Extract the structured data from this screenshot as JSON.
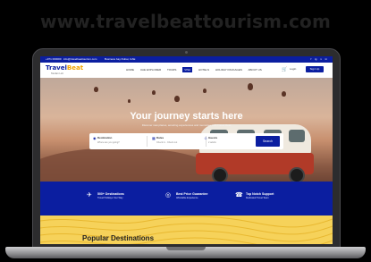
{
  "watermark": "www.travelbeattourism.com",
  "site": {
    "topbar": {
      "phone": "+971 000000",
      "email": "info@travelbeattourism.com",
      "address": "Business bay Dubai, UAE",
      "social": [
        "f",
        "ig",
        "x",
        "in"
      ]
    },
    "logo": {
      "text_main": "Travel",
      "text_accent": "Beat",
      "tagline": "Tourism LLC"
    },
    "menu": [
      "HOME",
      "UAE EXPLORER",
      "TOURS",
      "VISA",
      "HOTELS",
      "HOLIDAY PACKAGES",
      "ABOUT US"
    ],
    "menu_active_index": 3,
    "login_label": "Login",
    "signup_label": "Sign Up",
    "hero": {
      "title": "Your journey starts here",
      "subtitle": "Discover new places, amazing experiences and memories with Travel Beat",
      "search": {
        "fields": [
          {
            "icon": "pin-icon",
            "label": "Destination",
            "placeholder": "Where are you going?"
          },
          {
            "icon": "calendar-icon",
            "label": "Dates",
            "placeholder": "Check in - Check out"
          },
          {
            "icon": "guests-icon",
            "label": "Guests",
            "placeholder": "2 adults"
          }
        ],
        "button_label": "Search"
      }
    },
    "features": [
      {
        "icon": "plane-icon",
        "title": "500+ Destinations",
        "subtitle": "Travel Holidays Your Way"
      },
      {
        "icon": "price-tag-icon",
        "title": "Best Price Guarantee",
        "subtitle": "Affordable Experience"
      },
      {
        "icon": "headset-icon",
        "title": "Top Notch Support",
        "subtitle": "Dedicated Travel Team"
      }
    ],
    "section_title": "Popular Destinations"
  },
  "colors": {
    "primary": "#0b1ea0",
    "accent": "#f6d25a",
    "logo_accent": "#f2a400"
  }
}
